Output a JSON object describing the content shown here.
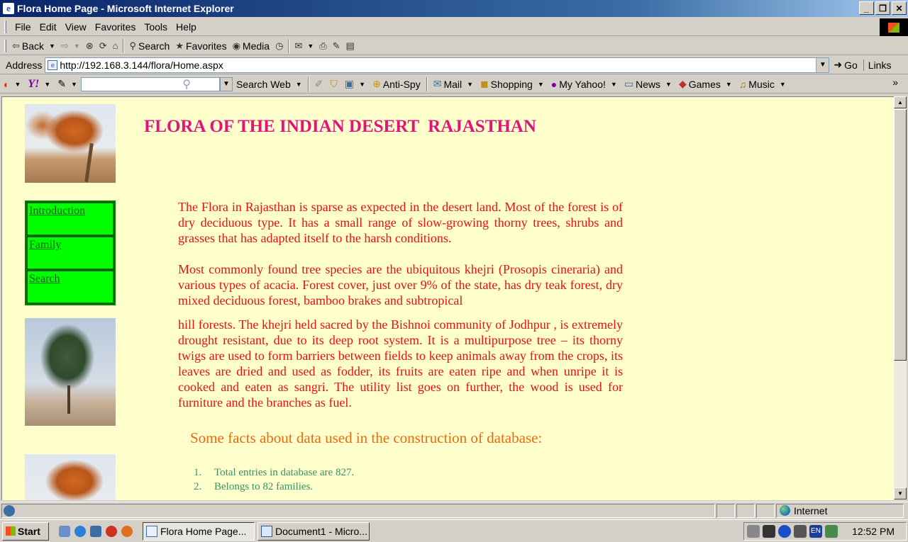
{
  "window": {
    "title": "Flora Home Page - Microsoft Internet Explorer",
    "min": "_",
    "max": "❐",
    "close": "✕"
  },
  "menu": [
    "File",
    "Edit",
    "View",
    "Favorites",
    "Tools",
    "Help"
  ],
  "toolbar": {
    "back": "Back",
    "search": "Search",
    "favorites": "Favorites",
    "media": "Media"
  },
  "address": {
    "label": "Address",
    "url": "http://192.168.3.144/flora/Home.aspx",
    "go": "Go",
    "links": "Links"
  },
  "ytoolbar": {
    "search_web": "Search Web",
    "antispy": "Anti-Spy",
    "mail": "Mail",
    "shopping": "Shopping",
    "my_yahoo": "My Yahoo!",
    "news": "News",
    "games": "Games",
    "music": "Music",
    "yahoo_logo": "Y!"
  },
  "page": {
    "heading": "FLORA OF THE INDIAN DESERT  RAJASTHAN",
    "nav": [
      "Introduction",
      "Family",
      "Search"
    ],
    "paragraphs": [
      "The Flora in Rajasthan is sparse as expected in the desert land. Most of the forest is of dry deciduous type. It has a small range of slow-growing thorny trees, shrubs and grasses that has adapted itself to the harsh conditions.",
      "Most commonly found tree species are the ubiquitous khejri (Prosopis cineraria) and various types of acacia. Forest cover, just over 9% of the state, has dry teak forest, dry mixed deciduous forest, bamboo brakes and subtropical",
      "hill forests. The khejri held sacred by the Bishnoi community of Jodhpur  , is extremely drought resistant, due to its deep root system. It is a multipurpose tree – its thorny twigs are used to form barriers between fields to keep animals away from the crops, its leaves are dried and used as fodder, its fruits are eaten ripe and when unripe it is cooked and eaten as sangri. The utility list goes on further, the wood is used for furniture and the branches as fuel."
    ],
    "facts_title": "Some facts about data used in the construction of database:",
    "facts": [
      {
        "num": "1.",
        "text": "Total entries in database are 827."
      },
      {
        "num": "2.",
        "text": "Belongs to 82 families."
      }
    ]
  },
  "status": {
    "zone": "Internet"
  },
  "taskbar": {
    "start": "Start",
    "tasks": [
      "Flora Home Page...",
      "Document1 - Micro..."
    ],
    "clock": "12:52 PM",
    "lang": "EN"
  }
}
